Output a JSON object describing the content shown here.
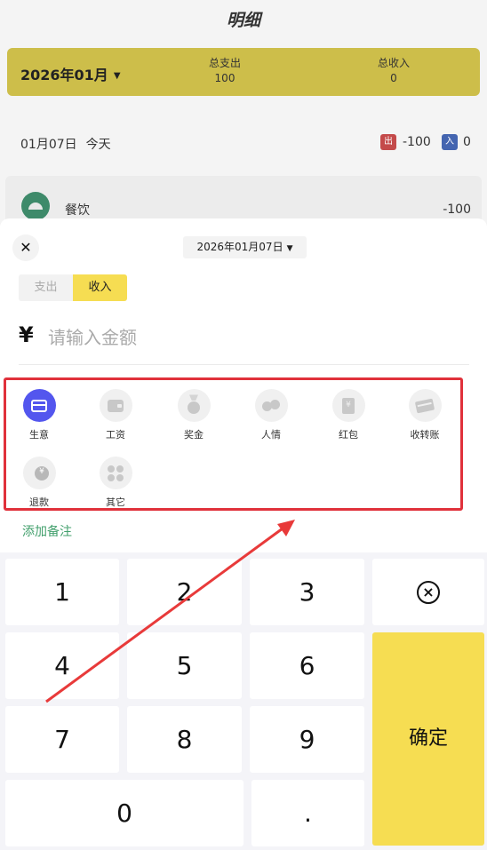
{
  "header": {
    "title": "明细"
  },
  "summary": {
    "month": "2026年01月",
    "expense_label": "总支出",
    "expense_value": "100",
    "income_label": "总收入",
    "income_value": "0"
  },
  "day": {
    "date": "01月07日",
    "weekday": "今天",
    "out_badge": "出",
    "out_value": "-100",
    "in_badge": "入",
    "in_value": "0"
  },
  "record": {
    "category": "餐饮",
    "amount": "-100"
  },
  "sheet": {
    "close_symbol": "✕",
    "date": "2026年01月07日",
    "tabs": [
      "支出",
      "收入"
    ],
    "active_tab": "收入",
    "currency": "¥",
    "amount_placeholder": "请输入金额",
    "categories": [
      {
        "label": "生意",
        "icon": "shop-icon",
        "selected": true
      },
      {
        "label": "工资",
        "icon": "wallet-icon"
      },
      {
        "label": "奖金",
        "icon": "medal-icon"
      },
      {
        "label": "人情",
        "icon": "gift-icon"
      },
      {
        "label": "红包",
        "icon": "red-packet-icon"
      },
      {
        "label": "收转账",
        "icon": "transfer-card-icon"
      },
      {
        "label": "退款",
        "icon": "refund-icon"
      },
      {
        "label": "其它",
        "icon": "grid-icon"
      }
    ],
    "add_note": "添加备注"
  },
  "keypad": {
    "keys": [
      "1",
      "2",
      "3",
      "4",
      "5",
      "6",
      "7",
      "8",
      "9",
      "0",
      "."
    ],
    "delete_symbol": "×",
    "confirm": "确定"
  },
  "colors": {
    "accent_yellow": "#f6dd52",
    "selected_category": "#5356ee",
    "note_green": "#43a06d",
    "highlight_red": "#e0313b"
  }
}
